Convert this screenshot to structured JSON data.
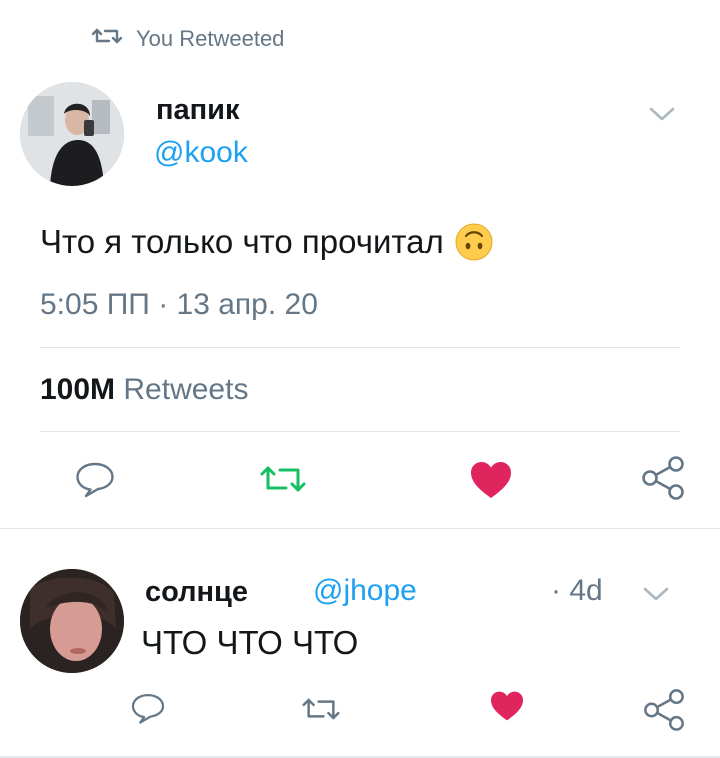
{
  "context": {
    "text": "You Retweeted"
  },
  "tweet": {
    "display_name": "папик",
    "handle": "@kook",
    "text": "Что я только что прочитал",
    "emoji": "upside-down-face",
    "time": "5:05 ПП",
    "separator": "·",
    "date": "13 апр. 20",
    "retweet_count": "100M",
    "retweet_label": "Retweets",
    "liked": true
  },
  "reply": {
    "display_name": "солнце",
    "handle": "@jhope",
    "time": "· 4d",
    "text": "ЧТО ЧТО ЧТО",
    "liked": true
  },
  "colors": {
    "link": "#1da1f2",
    "muted": "#657786",
    "retweeted": "#17bf63",
    "like": "#e0245e",
    "icon": "#657786"
  }
}
